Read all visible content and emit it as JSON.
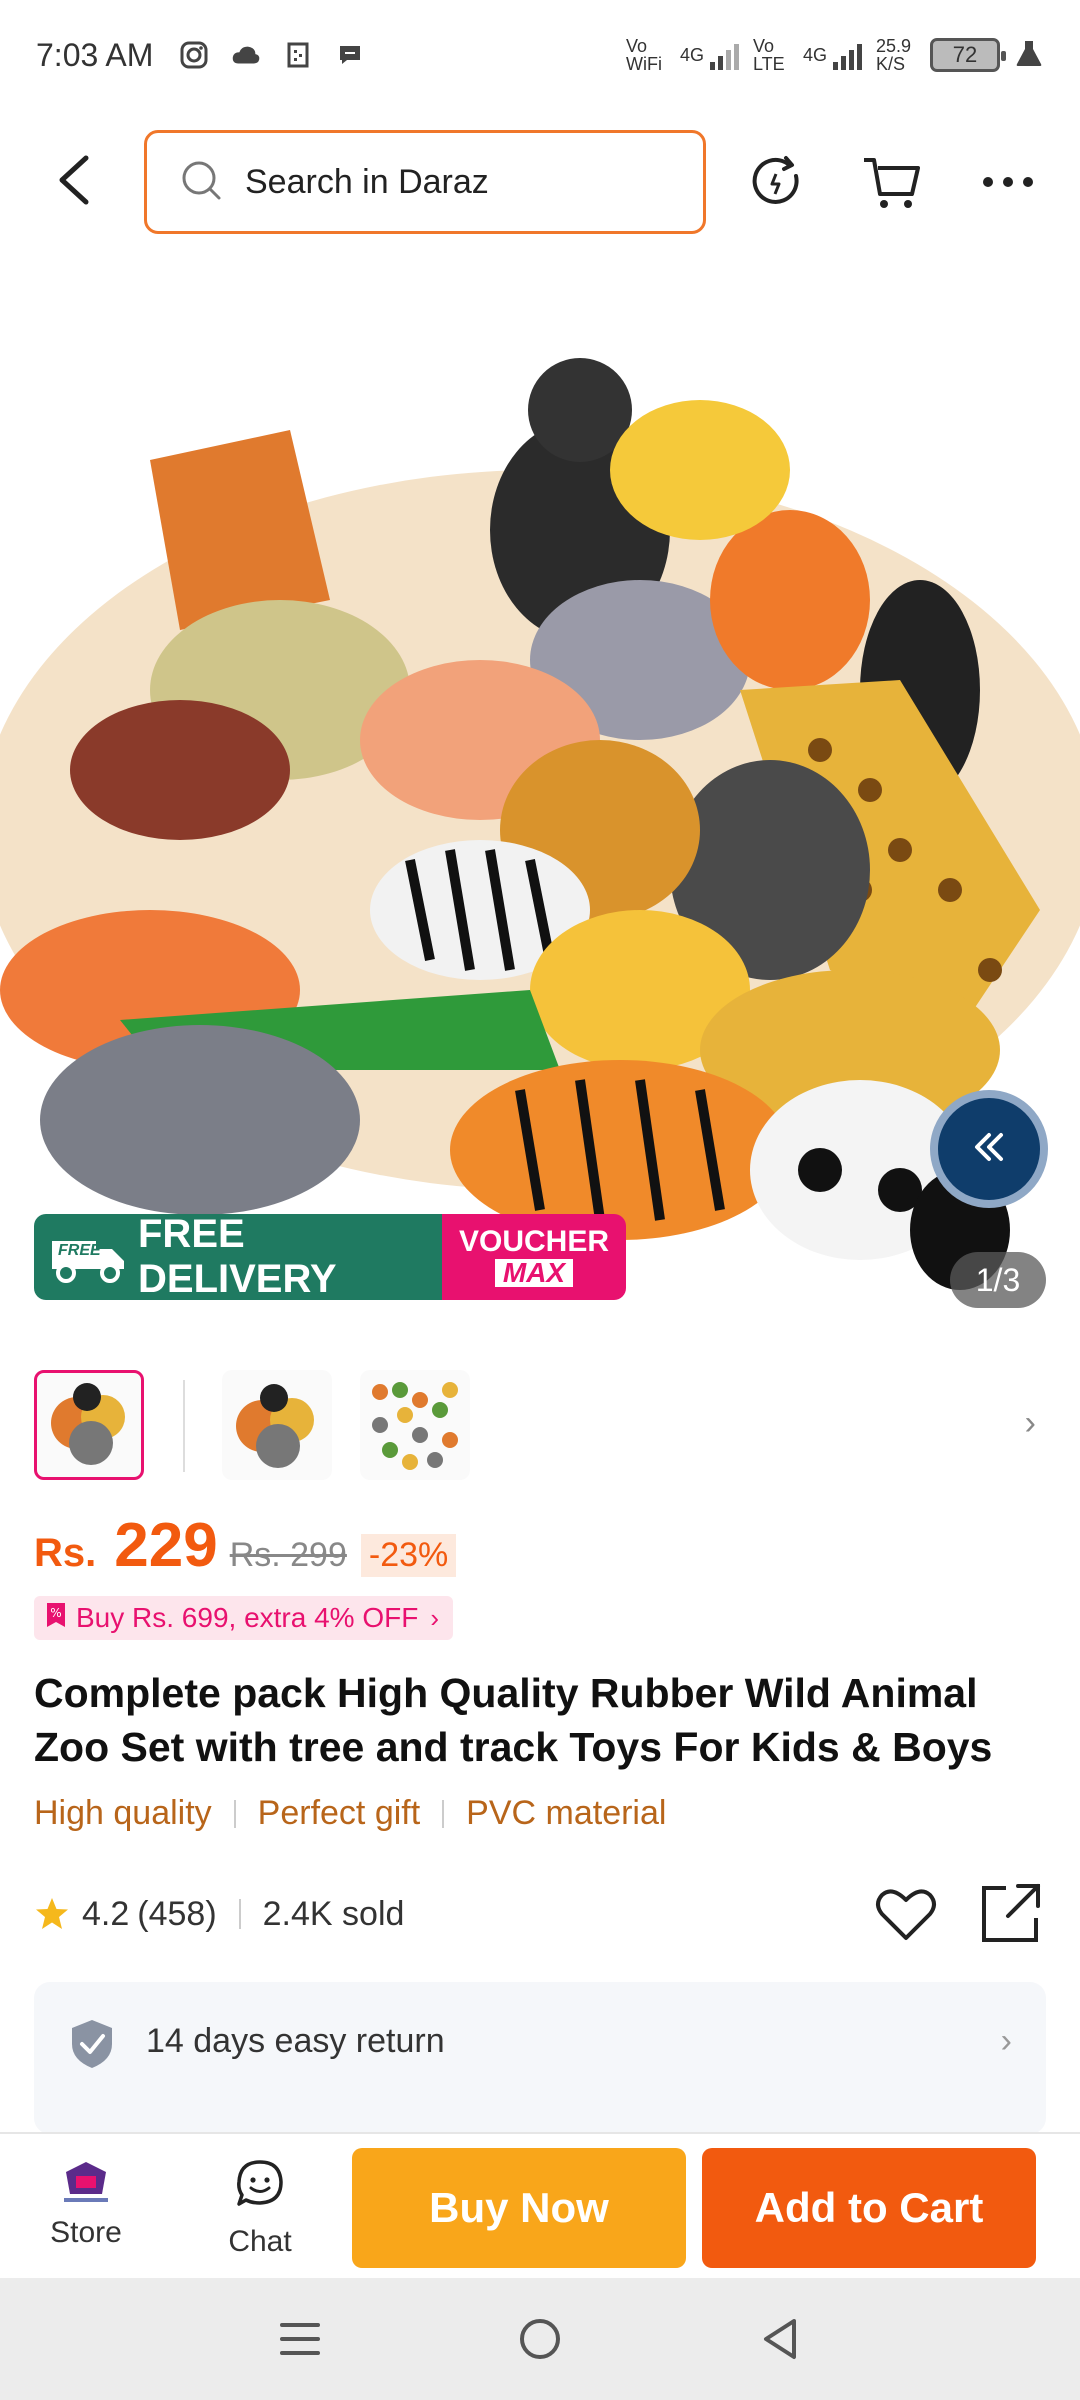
{
  "status_bar": {
    "time": "7:03 AM",
    "network_1": "Vo WiFi",
    "net_4g_1": "4G",
    "network_2": "Vo LTE",
    "net_4g_2": "4G",
    "speed": "25.9 K/S",
    "battery": "72"
  },
  "search": {
    "placeholder": "Search in Daraz"
  },
  "gallery": {
    "counter": "1/3",
    "promo_free": "FREE DELIVERY",
    "promo_free_badge": "FREE",
    "promo_voucher_1": "VOUCHER",
    "promo_voucher_2": "MAX"
  },
  "price": {
    "currency": "Rs.",
    "value": "229",
    "original": "Rs. 299",
    "discount": "-23%"
  },
  "deal": {
    "text": "Buy Rs. 699, extra 4% OFF"
  },
  "product": {
    "title": "Complete pack High Quality Rubber Wild Animal Zoo Set with tree and track Toys For Kids & Boys",
    "features": [
      "High quality",
      "Perfect gift",
      "PVC material"
    ],
    "rating": "4.2",
    "reviews": "(458)",
    "sold": "2.4K sold"
  },
  "service": {
    "return_label": "14 days easy return"
  },
  "action_bar": {
    "store_label": "Store",
    "chat_label": "Chat",
    "buy_now": "Buy Now",
    "add_to_cart": "Add to Cart"
  },
  "colors": {
    "accent_orange": "#f25a0f",
    "buy_now": "#f9a61a",
    "voucher_pink": "#e8116f",
    "free_delivery_green": "#1f7a61"
  }
}
